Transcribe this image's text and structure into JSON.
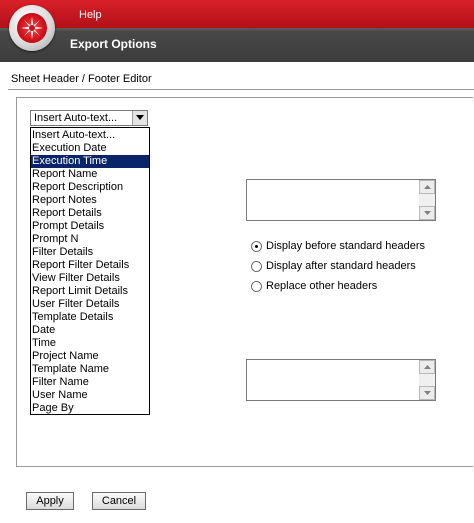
{
  "header": {
    "menu_help": "Help",
    "title": "Export Options",
    "logo_icon": "red-star-logo-icon"
  },
  "editor": {
    "title": "Sheet Header / Footer Editor"
  },
  "autotext": {
    "selected_value": "Insert Auto-text...",
    "options": [
      "Insert Auto-text...",
      "Execution Date",
      "Execution Time",
      "Report Name",
      "Report Description",
      "Report Notes",
      "Report Details",
      "Prompt Details",
      "Prompt N",
      "Filter Details",
      "Report Filter Details",
      "View Filter Details",
      "Report Limit Details",
      "User Filter Details",
      "Template Details",
      "Date",
      "Time",
      "Project Name",
      "Template Name",
      "Filter Name",
      "User Name",
      "Page By"
    ],
    "highlighted_index": 2
  },
  "header_text": {
    "value": ""
  },
  "footer_text": {
    "value": ""
  },
  "position_options": {
    "before": "Display before standard headers",
    "after": "Display after standard headers",
    "replace": "Replace other headers",
    "checked": "before"
  },
  "buttons": {
    "apply": "Apply",
    "cancel": "Cancel"
  },
  "colors": {
    "menu_red": "#c8161e",
    "header_gray": "#4a4a4a",
    "selection_blue": "#0a246a"
  }
}
